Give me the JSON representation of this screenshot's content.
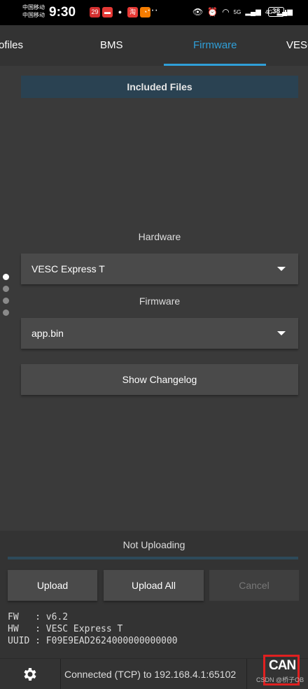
{
  "statusbar": {
    "carrier_1": "中国移动",
    "carrier_2": "中国移动",
    "time": "9:30",
    "app_icons": [
      {
        "name": "app-icon-1",
        "glyph": "29",
        "color": "#d32f2f"
      },
      {
        "name": "app-icon-2",
        "glyph": "▬",
        "color": "#e53935"
      },
      {
        "name": "app-icon-3",
        "glyph": "●",
        "color": "#000000"
      },
      {
        "name": "app-icon-4",
        "glyph": "淘",
        "color": "#e53935"
      },
      {
        "name": "app-icon-5",
        "glyph": "◔",
        "color": "#f57c00"
      }
    ],
    "more": "···",
    "signal_1": "5G",
    "signal_2": "4G",
    "battery": "38"
  },
  "tabs": [
    {
      "label": "ofiles",
      "active": false
    },
    {
      "label": "BMS",
      "active": false
    },
    {
      "label": "Firmware",
      "active": true
    },
    {
      "label": "VESC",
      "active": false
    }
  ],
  "main": {
    "included_files": "Included Files",
    "hardware_label": "Hardware",
    "hardware_value": "VESC Express T",
    "firmware_label": "Firmware",
    "firmware_value": "app.bin",
    "changelog_button": "Show Changelog",
    "page_indicator": {
      "count": 4,
      "active": 0
    }
  },
  "upload": {
    "status": "Not Uploading",
    "progress": 0,
    "upload_button": "Upload",
    "upload_all_button": "Upload All",
    "cancel_button": "Cancel"
  },
  "info": {
    "fw_line": "FW   : v6.2",
    "hw_line": "HW   : VESC Express T",
    "uuid_line": "UUID : F09E9EAD2624000000000000"
  },
  "footer": {
    "connection": "Connected (TCP) to 192.168.4.1:65102",
    "can_label": "CAN",
    "watermark": "CSDN @桥子OB"
  },
  "colors": {
    "accent": "#2f9fd8",
    "highlight_box": "#e02020"
  }
}
